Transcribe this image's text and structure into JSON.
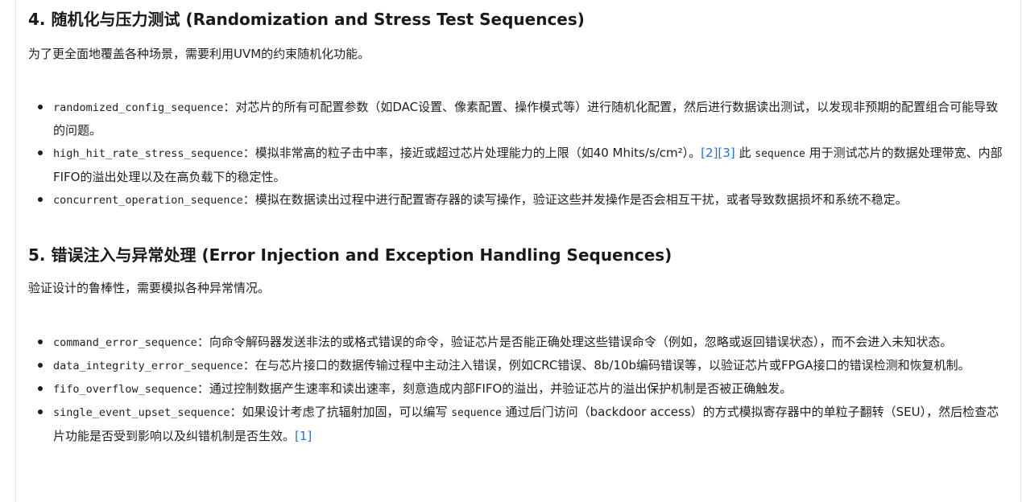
{
  "section4": {
    "title": "4. 随机化与压力测试 (Randomization and Stress Test Sequences)",
    "intro": "为了更全面地覆盖各种场景，需要利用UVM的约束随机化功能。",
    "items": [
      {
        "code": "randomized_config_sequence",
        "text": "：对芯片的所有可配置参数（如DAC设置、像素配置、操作模式等）进行随机化配置，然后进行数据读出测试，以发现非预期的配置组合可能导致的问题。"
      },
      {
        "code": "high_hit_rate_stress_sequence",
        "text_a": "：模拟非常高的粒子击中率，接近或超过芯片处理能力的上限（如40 Mhits/s/cm²）。",
        "cite_open": "[",
        "cite_1": "2",
        "cite_mid": "][",
        "cite_2": "3",
        "cite_close": "]",
        "text_b": " 此 ",
        "mono": "sequence",
        "text_c": " 用于测试芯片的数据处理带宽、内部FIFO的溢出处理以及在高负载下的稳定性。"
      },
      {
        "code": "concurrent_operation_sequence",
        "text": "：模拟在数据读出过程中进行配置寄存器的读写操作，验证这些并发操作是否会相互干扰，或者导致数据损坏和系统不稳定。"
      }
    ]
  },
  "section5": {
    "title": "5. 错误注入与异常处理 (Error Injection and Exception Handling Sequences)",
    "intro": "验证设计的鲁棒性，需要模拟各种异常情况。",
    "items": [
      {
        "code": "command_error_sequence",
        "text": "：向命令解码器发送非法的或格式错误的命令，验证芯片是否能正确处理这些错误命令（例如，忽略或返回错误状态），而不会进入未知状态。"
      },
      {
        "code": "data_integrity_error_sequence",
        "text": "：在与芯片接口的数据传输过程中主动注入错误，例如CRC错误、8b/10b编码错误等，以验证芯片或FPGA接口的错误检测和恢复机制。"
      },
      {
        "code": "fifo_overflow_sequence",
        "text": "：通过控制数据产生速率和读出速率，刻意造成内部FIFO的溢出，并验证芯片的溢出保护机制是否被正确触发。"
      },
      {
        "code": "single_event_upset_sequence",
        "text_a": "：如果设计考虑了抗辐射加固，可以编写 ",
        "mono": "sequence",
        "text_b": " 通过后门访问（backdoor access）的方式模拟寄存器中的单粒子翻转（SEU），然后检查芯片功能是否受到影响以及纠错机制是否生效。",
        "cite_open": "[",
        "cite_1": "1",
        "cite_close": "]"
      }
    ]
  }
}
